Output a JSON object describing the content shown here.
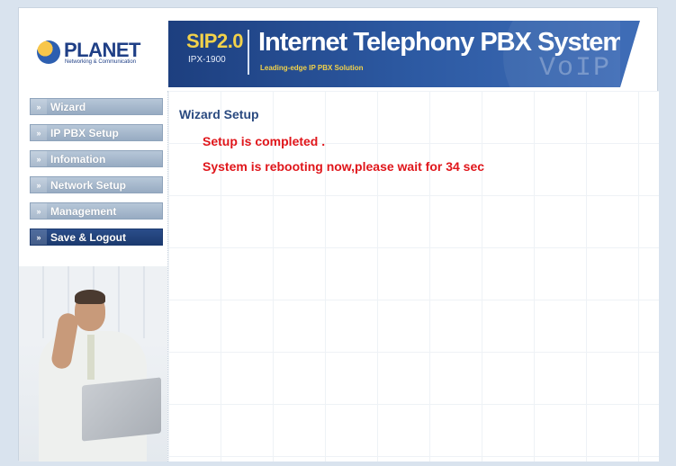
{
  "header": {
    "logo_word": "PLANET",
    "logo_tagline": "Networking & Communication",
    "sip_title": "SIP2.0",
    "model": "IPX-1900",
    "title": "Internet Telephony PBX System",
    "subtitle": "Leading-edge IP PBX Solution",
    "watermark": "VoIP"
  },
  "sidebar": {
    "items": [
      {
        "label": "Wizard",
        "active": false
      },
      {
        "label": "IP PBX Setup",
        "active": false
      },
      {
        "label": "Infomation",
        "active": false
      },
      {
        "label": "Network Setup",
        "active": false
      },
      {
        "label": "Management",
        "active": false
      },
      {
        "label": "Save & Logout",
        "active": true
      }
    ],
    "arrow_glyph": "»"
  },
  "main": {
    "section_title": "Wizard Setup",
    "message_complete": "Setup is completed .",
    "message_reboot": "System is rebooting now,please wait for 34 sec"
  },
  "colors": {
    "nav_inactive": "#97abc2",
    "nav_active": "#1c3a6f",
    "message": "#e0161b",
    "title": "#2a4a80",
    "banner": "#2d5aa3"
  }
}
